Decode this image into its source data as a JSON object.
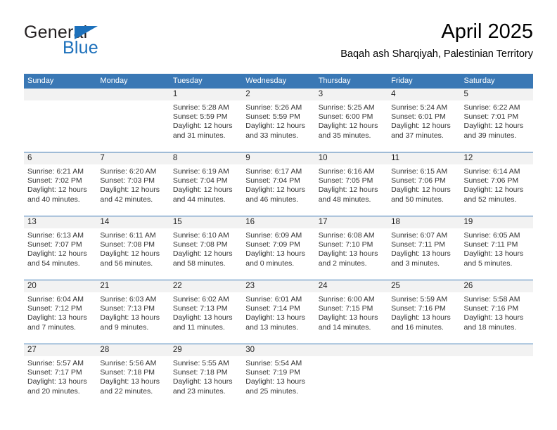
{
  "brand": {
    "name_part1": "General",
    "name_part2": "Blue",
    "triangle_icon": "brand-triangle-icon",
    "accent_color": "#1c70bb"
  },
  "header": {
    "title": "April 2025",
    "subtitle": "Baqah ash Sharqiyah, Palestinian Territory"
  },
  "calendar": {
    "header_bg": "#3a78b5",
    "daynum_band_bg": "#f2f2f2",
    "weekdays": [
      "Sunday",
      "Monday",
      "Tuesday",
      "Wednesday",
      "Thursday",
      "Friday",
      "Saturday"
    ],
    "weeks": [
      [
        {
          "day": "",
          "sunrise": "",
          "sunset": "",
          "daylight_line1": "",
          "daylight_line2": ""
        },
        {
          "day": "",
          "sunrise": "",
          "sunset": "",
          "daylight_line1": "",
          "daylight_line2": ""
        },
        {
          "day": "1",
          "sunrise": "Sunrise: 5:28 AM",
          "sunset": "Sunset: 5:59 PM",
          "daylight_line1": "Daylight: 12 hours",
          "daylight_line2": "and 31 minutes."
        },
        {
          "day": "2",
          "sunrise": "Sunrise: 5:26 AM",
          "sunset": "Sunset: 5:59 PM",
          "daylight_line1": "Daylight: 12 hours",
          "daylight_line2": "and 33 minutes."
        },
        {
          "day": "3",
          "sunrise": "Sunrise: 5:25 AM",
          "sunset": "Sunset: 6:00 PM",
          "daylight_line1": "Daylight: 12 hours",
          "daylight_line2": "and 35 minutes."
        },
        {
          "day": "4",
          "sunrise": "Sunrise: 5:24 AM",
          "sunset": "Sunset: 6:01 PM",
          "daylight_line1": "Daylight: 12 hours",
          "daylight_line2": "and 37 minutes."
        },
        {
          "day": "5",
          "sunrise": "Sunrise: 6:22 AM",
          "sunset": "Sunset: 7:01 PM",
          "daylight_line1": "Daylight: 12 hours",
          "daylight_line2": "and 39 minutes."
        }
      ],
      [
        {
          "day": "6",
          "sunrise": "Sunrise: 6:21 AM",
          "sunset": "Sunset: 7:02 PM",
          "daylight_line1": "Daylight: 12 hours",
          "daylight_line2": "and 40 minutes."
        },
        {
          "day": "7",
          "sunrise": "Sunrise: 6:20 AM",
          "sunset": "Sunset: 7:03 PM",
          "daylight_line1": "Daylight: 12 hours",
          "daylight_line2": "and 42 minutes."
        },
        {
          "day": "8",
          "sunrise": "Sunrise: 6:19 AM",
          "sunset": "Sunset: 7:04 PM",
          "daylight_line1": "Daylight: 12 hours",
          "daylight_line2": "and 44 minutes."
        },
        {
          "day": "9",
          "sunrise": "Sunrise: 6:17 AM",
          "sunset": "Sunset: 7:04 PM",
          "daylight_line1": "Daylight: 12 hours",
          "daylight_line2": "and 46 minutes."
        },
        {
          "day": "10",
          "sunrise": "Sunrise: 6:16 AM",
          "sunset": "Sunset: 7:05 PM",
          "daylight_line1": "Daylight: 12 hours",
          "daylight_line2": "and 48 minutes."
        },
        {
          "day": "11",
          "sunrise": "Sunrise: 6:15 AM",
          "sunset": "Sunset: 7:06 PM",
          "daylight_line1": "Daylight: 12 hours",
          "daylight_line2": "and 50 minutes."
        },
        {
          "day": "12",
          "sunrise": "Sunrise: 6:14 AM",
          "sunset": "Sunset: 7:06 PM",
          "daylight_line1": "Daylight: 12 hours",
          "daylight_line2": "and 52 minutes."
        }
      ],
      [
        {
          "day": "13",
          "sunrise": "Sunrise: 6:13 AM",
          "sunset": "Sunset: 7:07 PM",
          "daylight_line1": "Daylight: 12 hours",
          "daylight_line2": "and 54 minutes."
        },
        {
          "day": "14",
          "sunrise": "Sunrise: 6:11 AM",
          "sunset": "Sunset: 7:08 PM",
          "daylight_line1": "Daylight: 12 hours",
          "daylight_line2": "and 56 minutes."
        },
        {
          "day": "15",
          "sunrise": "Sunrise: 6:10 AM",
          "sunset": "Sunset: 7:08 PM",
          "daylight_line1": "Daylight: 12 hours",
          "daylight_line2": "and 58 minutes."
        },
        {
          "day": "16",
          "sunrise": "Sunrise: 6:09 AM",
          "sunset": "Sunset: 7:09 PM",
          "daylight_line1": "Daylight: 13 hours",
          "daylight_line2": "and 0 minutes."
        },
        {
          "day": "17",
          "sunrise": "Sunrise: 6:08 AM",
          "sunset": "Sunset: 7:10 PM",
          "daylight_line1": "Daylight: 13 hours",
          "daylight_line2": "and 2 minutes."
        },
        {
          "day": "18",
          "sunrise": "Sunrise: 6:07 AM",
          "sunset": "Sunset: 7:11 PM",
          "daylight_line1": "Daylight: 13 hours",
          "daylight_line2": "and 3 minutes."
        },
        {
          "day": "19",
          "sunrise": "Sunrise: 6:05 AM",
          "sunset": "Sunset: 7:11 PM",
          "daylight_line1": "Daylight: 13 hours",
          "daylight_line2": "and 5 minutes."
        }
      ],
      [
        {
          "day": "20",
          "sunrise": "Sunrise: 6:04 AM",
          "sunset": "Sunset: 7:12 PM",
          "daylight_line1": "Daylight: 13 hours",
          "daylight_line2": "and 7 minutes."
        },
        {
          "day": "21",
          "sunrise": "Sunrise: 6:03 AM",
          "sunset": "Sunset: 7:13 PM",
          "daylight_line1": "Daylight: 13 hours",
          "daylight_line2": "and 9 minutes."
        },
        {
          "day": "22",
          "sunrise": "Sunrise: 6:02 AM",
          "sunset": "Sunset: 7:13 PM",
          "daylight_line1": "Daylight: 13 hours",
          "daylight_line2": "and 11 minutes."
        },
        {
          "day": "23",
          "sunrise": "Sunrise: 6:01 AM",
          "sunset": "Sunset: 7:14 PM",
          "daylight_line1": "Daylight: 13 hours",
          "daylight_line2": "and 13 minutes."
        },
        {
          "day": "24",
          "sunrise": "Sunrise: 6:00 AM",
          "sunset": "Sunset: 7:15 PM",
          "daylight_line1": "Daylight: 13 hours",
          "daylight_line2": "and 14 minutes."
        },
        {
          "day": "25",
          "sunrise": "Sunrise: 5:59 AM",
          "sunset": "Sunset: 7:16 PM",
          "daylight_line1": "Daylight: 13 hours",
          "daylight_line2": "and 16 minutes."
        },
        {
          "day": "26",
          "sunrise": "Sunrise: 5:58 AM",
          "sunset": "Sunset: 7:16 PM",
          "daylight_line1": "Daylight: 13 hours",
          "daylight_line2": "and 18 minutes."
        }
      ],
      [
        {
          "day": "27",
          "sunrise": "Sunrise: 5:57 AM",
          "sunset": "Sunset: 7:17 PM",
          "daylight_line1": "Daylight: 13 hours",
          "daylight_line2": "and 20 minutes."
        },
        {
          "day": "28",
          "sunrise": "Sunrise: 5:56 AM",
          "sunset": "Sunset: 7:18 PM",
          "daylight_line1": "Daylight: 13 hours",
          "daylight_line2": "and 22 minutes."
        },
        {
          "day": "29",
          "sunrise": "Sunrise: 5:55 AM",
          "sunset": "Sunset: 7:18 PM",
          "daylight_line1": "Daylight: 13 hours",
          "daylight_line2": "and 23 minutes."
        },
        {
          "day": "30",
          "sunrise": "Sunrise: 5:54 AM",
          "sunset": "Sunset: 7:19 PM",
          "daylight_line1": "Daylight: 13 hours",
          "daylight_line2": "and 25 minutes."
        },
        {
          "day": "",
          "sunrise": "",
          "sunset": "",
          "daylight_line1": "",
          "daylight_line2": ""
        },
        {
          "day": "",
          "sunrise": "",
          "sunset": "",
          "daylight_line1": "",
          "daylight_line2": ""
        },
        {
          "day": "",
          "sunrise": "",
          "sunset": "",
          "daylight_line1": "",
          "daylight_line2": ""
        }
      ]
    ]
  }
}
